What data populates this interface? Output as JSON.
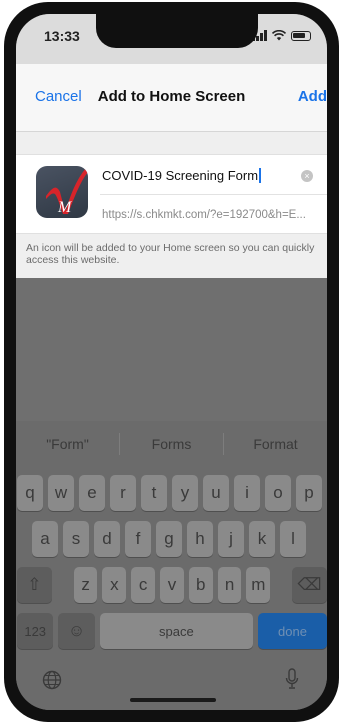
{
  "status_bar": {
    "time": "13:33"
  },
  "navbar": {
    "cancel_label": "Cancel",
    "title": "Add to Home Screen",
    "add_label": "Add"
  },
  "shortcut": {
    "name_value": "COVID-19 Screening Form",
    "url": "https://s.chkmkt.com/?e=192700&h=E...",
    "clear_symbol": "×",
    "hint": "An icon will be added to your Home screen so you can quickly access this website."
  },
  "keyboard": {
    "suggestions": [
      "\"Form\"",
      "Forms",
      "Format"
    ],
    "row1": [
      "q",
      "w",
      "e",
      "r",
      "t",
      "y",
      "u",
      "i",
      "o",
      "p"
    ],
    "row2": [
      "a",
      "s",
      "d",
      "f",
      "g",
      "h",
      "j",
      "k",
      "l"
    ],
    "row3": [
      "z",
      "x",
      "c",
      "v",
      "b",
      "n",
      "m"
    ],
    "numbers_label": "123",
    "space_label": "space",
    "done_label": "done",
    "shift_symbol": "⇧",
    "delete_symbol": "⌫",
    "emoji_symbol": "☺"
  },
  "colors": {
    "accent": "#1a73e8",
    "done_key": "#1a5ea8"
  }
}
